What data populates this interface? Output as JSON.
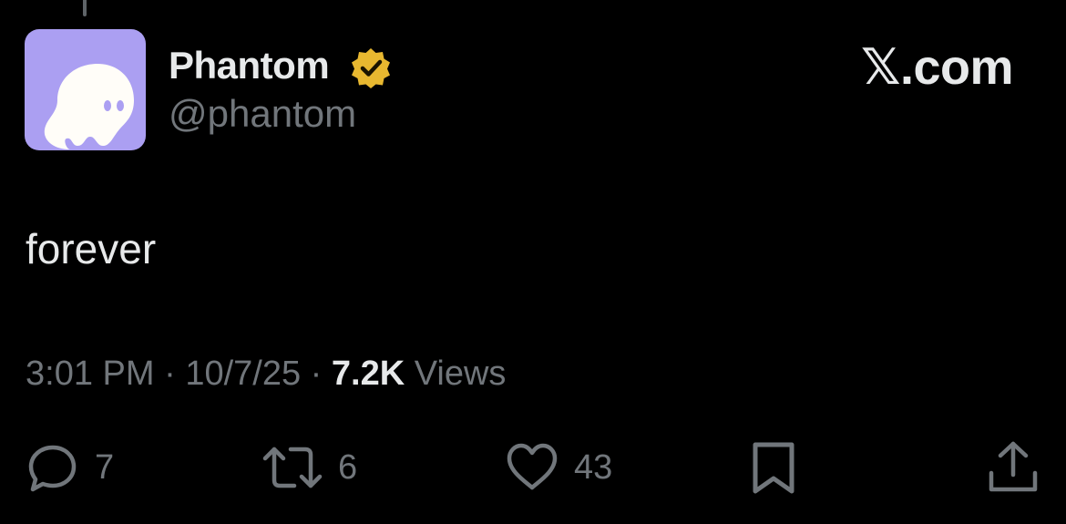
{
  "author": {
    "display_name": "Phantom",
    "handle": "@phantom",
    "verified": true,
    "avatar_color": "#ab9ff2"
  },
  "brand": {
    "label": "𝕏.com"
  },
  "post": {
    "text": "forever",
    "time": "3:01 PM",
    "date": "10/7/25",
    "views_count": "7.2K",
    "views_label": "Views"
  },
  "actions": {
    "replies": "7",
    "reposts": "6",
    "likes": "43"
  },
  "colors": {
    "background": "#000000",
    "primary_text": "#e7e9ea",
    "secondary_text": "#71767b",
    "verified_badge": "#e8b830"
  },
  "icons": [
    "ghost-icon",
    "verified-badge-icon",
    "reply-icon",
    "repost-icon",
    "like-icon",
    "bookmark-icon",
    "share-icon"
  ]
}
